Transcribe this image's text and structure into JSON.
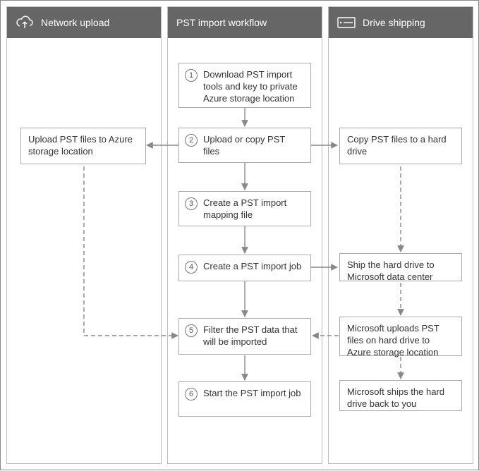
{
  "columns": {
    "left": {
      "title": "Network upload"
    },
    "mid": {
      "title": "PST import workflow"
    },
    "right": {
      "title": "Drive shipping"
    }
  },
  "workflow": {
    "s1": {
      "num": "1",
      "text": "Download PST import tools and key to private Azure storage location"
    },
    "s2": {
      "num": "2",
      "text": "Upload or copy PST files"
    },
    "s3": {
      "num": "3",
      "text": "Create a PST import mapping file"
    },
    "s4": {
      "num": "4",
      "text": "Create a PST import job"
    },
    "s5": {
      "num": "5",
      "text": "Filter the PST data that will be imported"
    },
    "s6": {
      "num": "6",
      "text": "Start the PST import job"
    }
  },
  "left_box": {
    "text": "Upload PST files to Azure storage location"
  },
  "right": {
    "r1": {
      "text": "Copy PST files to a hard drive"
    },
    "r2": {
      "text": "Ship the hard drive to Microsoft data center"
    },
    "r3": {
      "text": "Microsoft uploads PST files on hard drive to Azure storage location"
    },
    "r4": {
      "text": "Microsoft ships the hard drive back to you"
    }
  },
  "chart_data": {
    "type": "flowchart",
    "lanes": [
      {
        "id": "net",
        "title": "Network upload"
      },
      {
        "id": "wf",
        "title": "PST import workflow"
      },
      {
        "id": "drv",
        "title": "Drive shipping"
      }
    ],
    "nodes": [
      {
        "id": "s1",
        "lane": "wf",
        "order": 1,
        "label": "Download PST import tools and key to private Azure storage location"
      },
      {
        "id": "s2",
        "lane": "wf",
        "order": 2,
        "label": "Upload or copy PST files"
      },
      {
        "id": "s3",
        "lane": "wf",
        "order": 3,
        "label": "Create a PST import mapping file"
      },
      {
        "id": "s4",
        "lane": "wf",
        "order": 4,
        "label": "Create a PST import job"
      },
      {
        "id": "s5",
        "lane": "wf",
        "order": 5,
        "label": "Filter the PST data that will be imported"
      },
      {
        "id": "s6",
        "lane": "wf",
        "order": 6,
        "label": "Start the PST import job"
      },
      {
        "id": "L1",
        "lane": "net",
        "label": "Upload PST files to Azure storage location"
      },
      {
        "id": "R1",
        "lane": "drv",
        "label": "Copy PST files to a hard drive"
      },
      {
        "id": "R2",
        "lane": "drv",
        "label": "Ship the hard drive to Microsoft data center"
      },
      {
        "id": "R3",
        "lane": "drv",
        "label": "Microsoft uploads PST files on hard drive to Azure storage location"
      },
      {
        "id": "R4",
        "lane": "drv",
        "label": "Microsoft ships the hard drive back to you"
      }
    ],
    "edges": [
      {
        "from": "s1",
        "to": "s2",
        "style": "solid"
      },
      {
        "from": "s2",
        "to": "s3",
        "style": "solid"
      },
      {
        "from": "s3",
        "to": "s4",
        "style": "solid"
      },
      {
        "from": "s4",
        "to": "s5",
        "style": "solid"
      },
      {
        "from": "s5",
        "to": "s6",
        "style": "solid"
      },
      {
        "from": "s2",
        "to": "L1",
        "style": "solid"
      },
      {
        "from": "s2",
        "to": "R1",
        "style": "solid"
      },
      {
        "from": "s4",
        "to": "R2",
        "style": "solid"
      },
      {
        "from": "L1",
        "to": "s5",
        "style": "dashed"
      },
      {
        "from": "R1",
        "to": "R2",
        "style": "dashed"
      },
      {
        "from": "R2",
        "to": "R3",
        "style": "dashed"
      },
      {
        "from": "R3",
        "to": "s5",
        "style": "dashed"
      },
      {
        "from": "R3",
        "to": "R4",
        "style": "dashed"
      }
    ]
  }
}
